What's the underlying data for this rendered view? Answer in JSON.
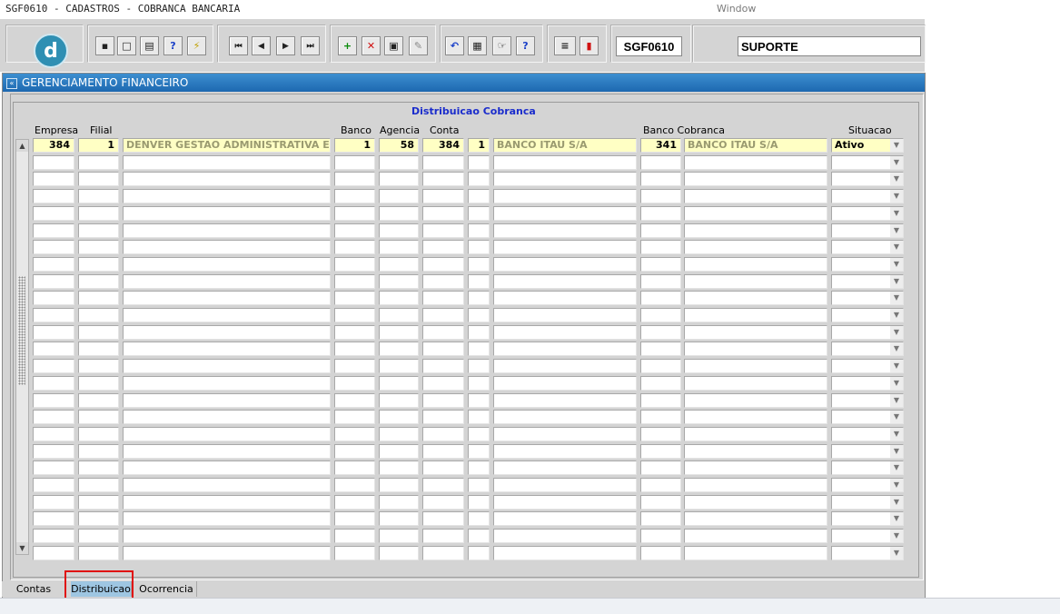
{
  "menubar": {
    "title": "SGF0610 - CADASTROS - COBRANCA BANCARIA",
    "window_label": "Window"
  },
  "toolbar": {
    "logo_letter": "d",
    "buttons": [
      {
        "name": "save-icon",
        "glyph": "▪"
      },
      {
        "name": "print-preview-icon",
        "glyph": "□"
      },
      {
        "name": "print-icon",
        "glyph": "▤"
      },
      {
        "name": "query-icon",
        "glyph": "?"
      },
      {
        "name": "execute-query-icon",
        "glyph": "⚡"
      },
      {
        "name": "first-record-icon",
        "glyph": "⏮"
      },
      {
        "name": "previous-record-icon",
        "glyph": "◀"
      },
      {
        "name": "next-record-icon",
        "glyph": "▶"
      },
      {
        "name": "last-record-icon",
        "glyph": "⏭"
      },
      {
        "name": "insert-record-icon",
        "glyph": "+"
      },
      {
        "name": "delete-record-icon",
        "glyph": "✕"
      },
      {
        "name": "clear-record-icon",
        "glyph": "▣"
      },
      {
        "name": "lock-record-icon",
        "glyph": "✎"
      },
      {
        "name": "undo-icon",
        "glyph": "↶"
      },
      {
        "name": "list-values-icon",
        "glyph": "▦"
      },
      {
        "name": "edit-icon",
        "glyph": "☞"
      },
      {
        "name": "help-icon",
        "glyph": "?"
      },
      {
        "name": "menu-icon",
        "glyph": "≡"
      },
      {
        "name": "exit-icon",
        "glyph": "▮"
      }
    ],
    "form_code": "SGF0610",
    "user": "SUPORTE",
    "colors": {
      "toolbar_bg": "#d4d4d4",
      "button_bg": "#e9e9e9"
    }
  },
  "window": {
    "title": "GERENCIAMENTO FINANCEIRO",
    "frame_title": "Distribuicao Cobranca",
    "headers": {
      "empresa": "Empresa",
      "filial": "Filial",
      "banco": "Banco",
      "agencia": "Agencia",
      "conta": "Conta",
      "banco_cobranca": "Banco Cobranca",
      "situacao": "Situacao"
    },
    "rows": [
      {
        "empresa": "384",
        "filial": "1",
        "nome": "DENVER GESTAO ADMINISTRATIVA E TECN",
        "banco": "1",
        "agencia": "58",
        "conta": "384",
        "cod": "1",
        "banco_nome": "BANCO ITAU S/A",
        "banco_cob": "341",
        "banco_cob_nome": "BANCO ITAU S/A",
        "situacao": "Ativo"
      }
    ],
    "empty_rows": 24,
    "colors": {
      "title_bar": "#2a78c0",
      "active_field": "#ffffc4",
      "frame_title": "#1a2ccc"
    }
  },
  "tabs": [
    {
      "label": "Contas",
      "active": false
    },
    {
      "label": "Distribuicao",
      "active": true
    },
    {
      "label": "Ocorrencia",
      "active": false
    }
  ],
  "highlight_color": "#e01010"
}
